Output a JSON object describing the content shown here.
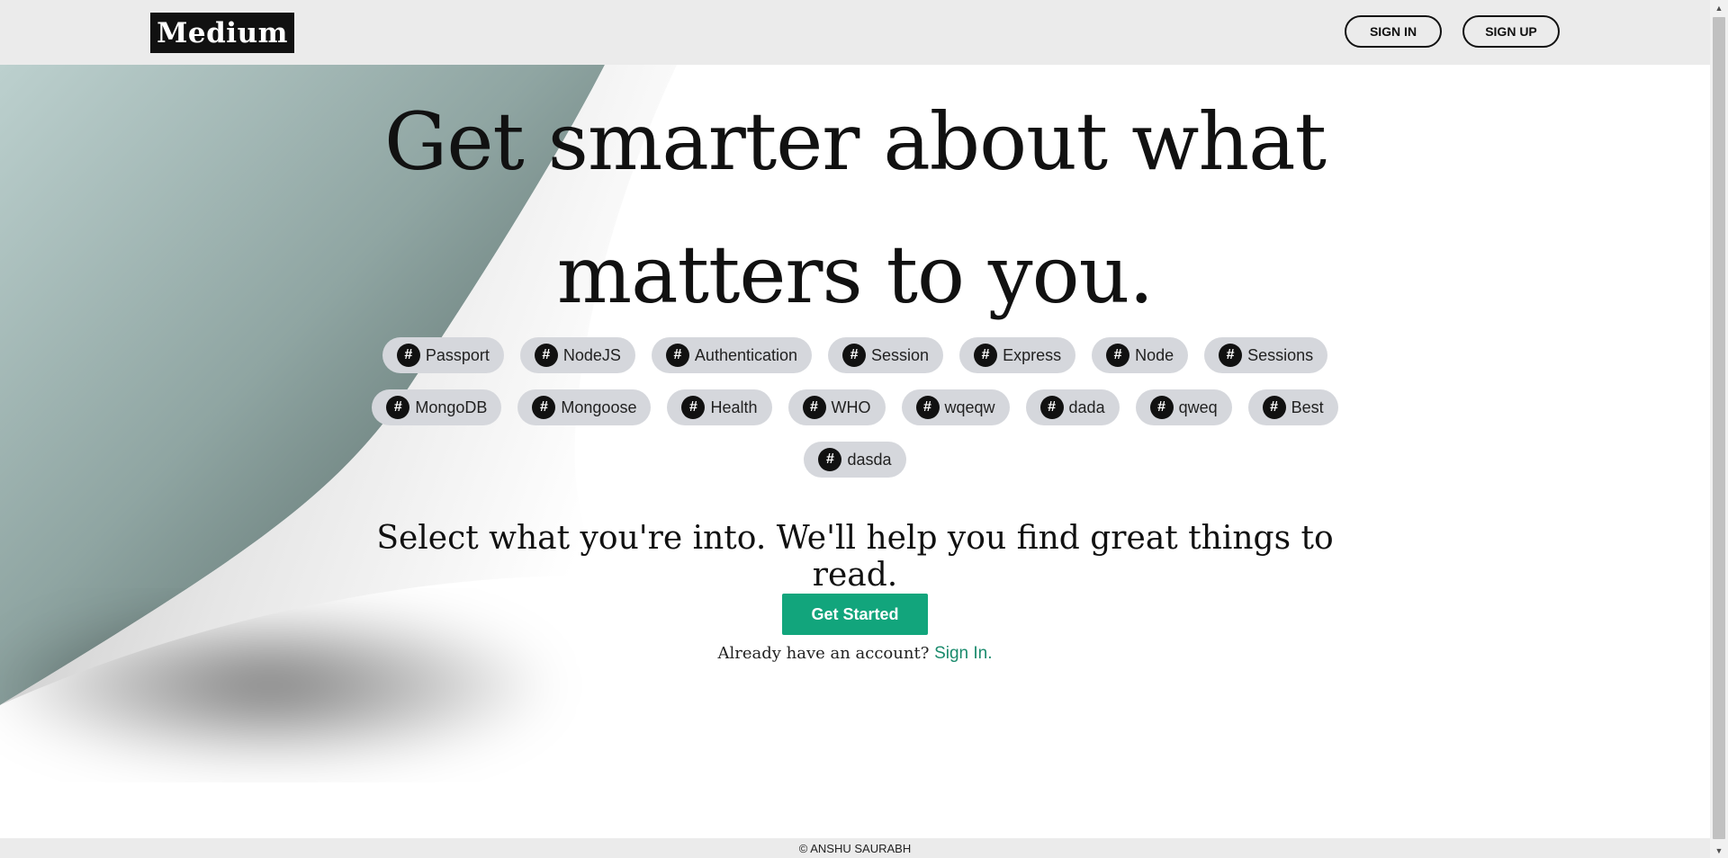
{
  "header": {
    "logo": "Medium",
    "sign_in": "SIGN IN",
    "sign_up": "SIGN UP"
  },
  "hero": {
    "title": "Get smarter about what matters to you.",
    "subtitle": "Select what you're into. We'll help you find great things to read.",
    "cta": "Get Started",
    "account_prompt": "Already have an account?",
    "sign_in_link": "Sign In."
  },
  "tags": [
    {
      "icon": "#",
      "label": "Passport"
    },
    {
      "icon": "#",
      "label": "NodeJS"
    },
    {
      "icon": "#",
      "label": "Authentication"
    },
    {
      "icon": "#",
      "label": "Session"
    },
    {
      "icon": "#",
      "label": "Express"
    },
    {
      "icon": "#",
      "label": "Node"
    },
    {
      "icon": "#",
      "label": "Sessions"
    },
    {
      "icon": "#",
      "label": "MongoDB"
    },
    {
      "icon": "#",
      "label": "Mongoose"
    },
    {
      "icon": "#",
      "label": "Health"
    },
    {
      "icon": "#",
      "label": "WHO"
    },
    {
      "icon": "#",
      "label": "wqeqw"
    },
    {
      "icon": "#",
      "label": "dada"
    },
    {
      "icon": "#",
      "label": "qweq"
    },
    {
      "icon": "#",
      "label": "Best"
    },
    {
      "icon": "#",
      "label": "dasda"
    }
  ],
  "footer": {
    "copyright": "© ANSHU SAURABH"
  },
  "colors": {
    "accent": "#12a57c",
    "link": "#1a8a6c",
    "tag_bg": "#d5d7dc",
    "header_bg": "#ebebeb"
  }
}
